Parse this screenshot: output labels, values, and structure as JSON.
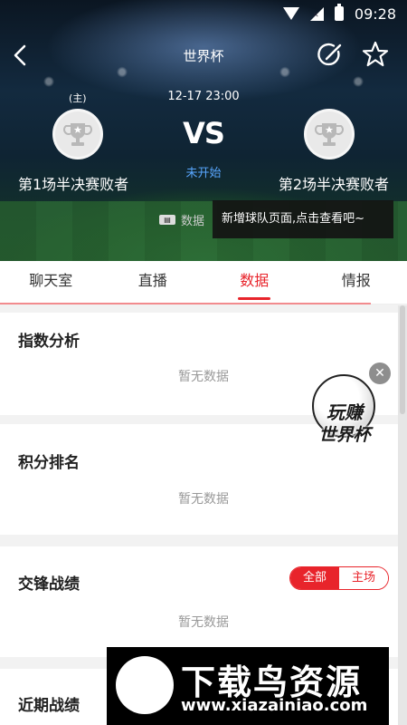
{
  "status_bar": {
    "time": "09:28"
  },
  "nav": {
    "title": "世界杯"
  },
  "match": {
    "datetime": "12-17 23:00",
    "home_tag": "(主)",
    "vs": "VS",
    "status": "未开始",
    "home_team": "第1场半决赛败者",
    "away_team": "第2场半决赛败者"
  },
  "data_chip": {
    "label": "数据"
  },
  "tooltip": {
    "text": "新增球队页面,点击查看吧~"
  },
  "tabs": [
    {
      "label": "聊天室",
      "active": false
    },
    {
      "label": "直播",
      "active": false
    },
    {
      "label": "数据",
      "active": true
    },
    {
      "label": "情报",
      "active": false
    }
  ],
  "sections": {
    "index_analysis": {
      "title": "指数分析",
      "empty": "暂无数据"
    },
    "ranking": {
      "title": "积分排名",
      "empty": "暂无数据"
    },
    "head_to_head": {
      "title": "交锋战绩",
      "empty": "暂无数据",
      "filter_all": "全部",
      "filter_home": "主场"
    },
    "recent": {
      "title": "近期战绩"
    }
  },
  "promo": {
    "line1": "玩赚",
    "line2": "世界杯"
  },
  "watermark": {
    "title": "下载鸟资源",
    "url": "www.xiazainiao.com"
  },
  "colors": {
    "accent": "#e8242b",
    "status_blue": "#59a7ff"
  }
}
